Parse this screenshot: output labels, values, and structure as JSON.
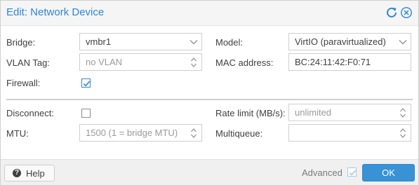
{
  "window": {
    "title": "Edit: Network Device",
    "tools": [
      "reset-icon",
      "close-icon"
    ]
  },
  "form": {
    "bridge": {
      "label": "Bridge:",
      "value": "vmbr1"
    },
    "vlan_tag": {
      "label": "VLAN Tag:",
      "placeholder": "no VLAN"
    },
    "firewall": {
      "label": "Firewall:",
      "checked": true
    },
    "model": {
      "label": "Model:",
      "value": "VirtIO (paravirtualized)"
    },
    "mac_address": {
      "label": "MAC address:",
      "value": "BC:24:11:42:F0:71"
    },
    "disconnect": {
      "label": "Disconnect:",
      "checked": false
    },
    "mtu": {
      "label": "MTU:",
      "placeholder": "1500 (1 = bridge MTU)"
    },
    "rate_limit": {
      "label": "Rate limit (MB/s):",
      "placeholder": "unlimited"
    },
    "multiqueue": {
      "label": "Multiqueue:",
      "value": ""
    }
  },
  "footer": {
    "help_label": "Help",
    "advanced_label": "Advanced",
    "advanced_checked": true,
    "ok_label": "OK"
  },
  "colors": {
    "accent": "#2c87d6",
    "ok_button": "#3892d3",
    "footer_bg": "#f0f0f0"
  }
}
